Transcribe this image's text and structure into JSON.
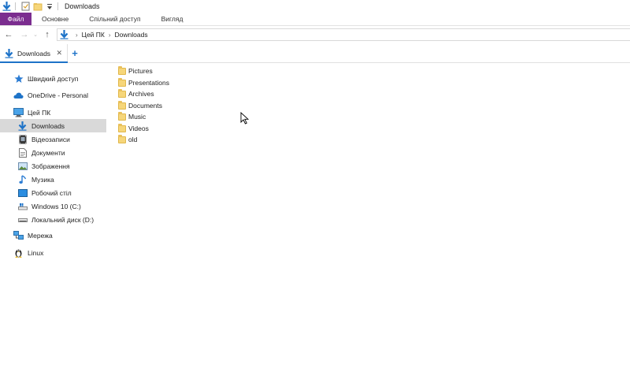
{
  "window": {
    "title": "Downloads"
  },
  "quick_access_toolbar": {
    "icons": [
      "download-arrow-icon",
      "properties-icon",
      "new-folder-icon",
      "customize-dropdown-icon"
    ]
  },
  "ribbon": {
    "tabs": [
      {
        "label": "Файл",
        "active": true
      },
      {
        "label": "Основне"
      },
      {
        "label": "Спільний доступ"
      },
      {
        "label": "Вигляд"
      }
    ],
    "file_tab_color": "#7b2d8f"
  },
  "navigation": {
    "back": "←",
    "forward": "→",
    "recent": "⌄",
    "up": "↑"
  },
  "address_bar": {
    "crumbs": [
      "Цей ПК",
      "Downloads"
    ],
    "separator": "›"
  },
  "tabs": {
    "items": [
      {
        "label": "Downloads",
        "close": "✕"
      }
    ],
    "new_tab": "+",
    "accent": "#1e73c8"
  },
  "sidebar": {
    "items": [
      {
        "label": "Швидкий доступ",
        "icon": "star-icon"
      },
      {
        "label": "OneDrive - Personal",
        "icon": "cloud-icon"
      },
      {
        "label": "Цей ПК",
        "icon": "computer-icon"
      },
      {
        "label": "Downloads",
        "icon": "download-arrow-icon",
        "selected": true
      },
      {
        "label": "Відеозаписи",
        "icon": "video-icon"
      },
      {
        "label": "Документи",
        "icon": "document-icon"
      },
      {
        "label": "Зображення",
        "icon": "picture-icon"
      },
      {
        "label": "Музика",
        "icon": "music-icon"
      },
      {
        "label": "Робочий стіл",
        "icon": "desktop-icon"
      },
      {
        "label": "Windows 10 (C:)",
        "icon": "drive-windows-icon"
      },
      {
        "label": "Локальний диск (D:)",
        "icon": "drive-icon"
      },
      {
        "label": "Мережа",
        "icon": "network-icon"
      },
      {
        "label": "Linux",
        "icon": "linux-penguin-icon"
      }
    ]
  },
  "files": [
    {
      "name": "Pictures",
      "type": "folder"
    },
    {
      "name": "Presentations",
      "type": "folder"
    },
    {
      "name": "Archives",
      "type": "folder"
    },
    {
      "name": "Documents",
      "type": "folder"
    },
    {
      "name": "Music",
      "type": "folder"
    },
    {
      "name": "Videos",
      "type": "folder"
    },
    {
      "name": "old",
      "type": "folder"
    }
  ]
}
